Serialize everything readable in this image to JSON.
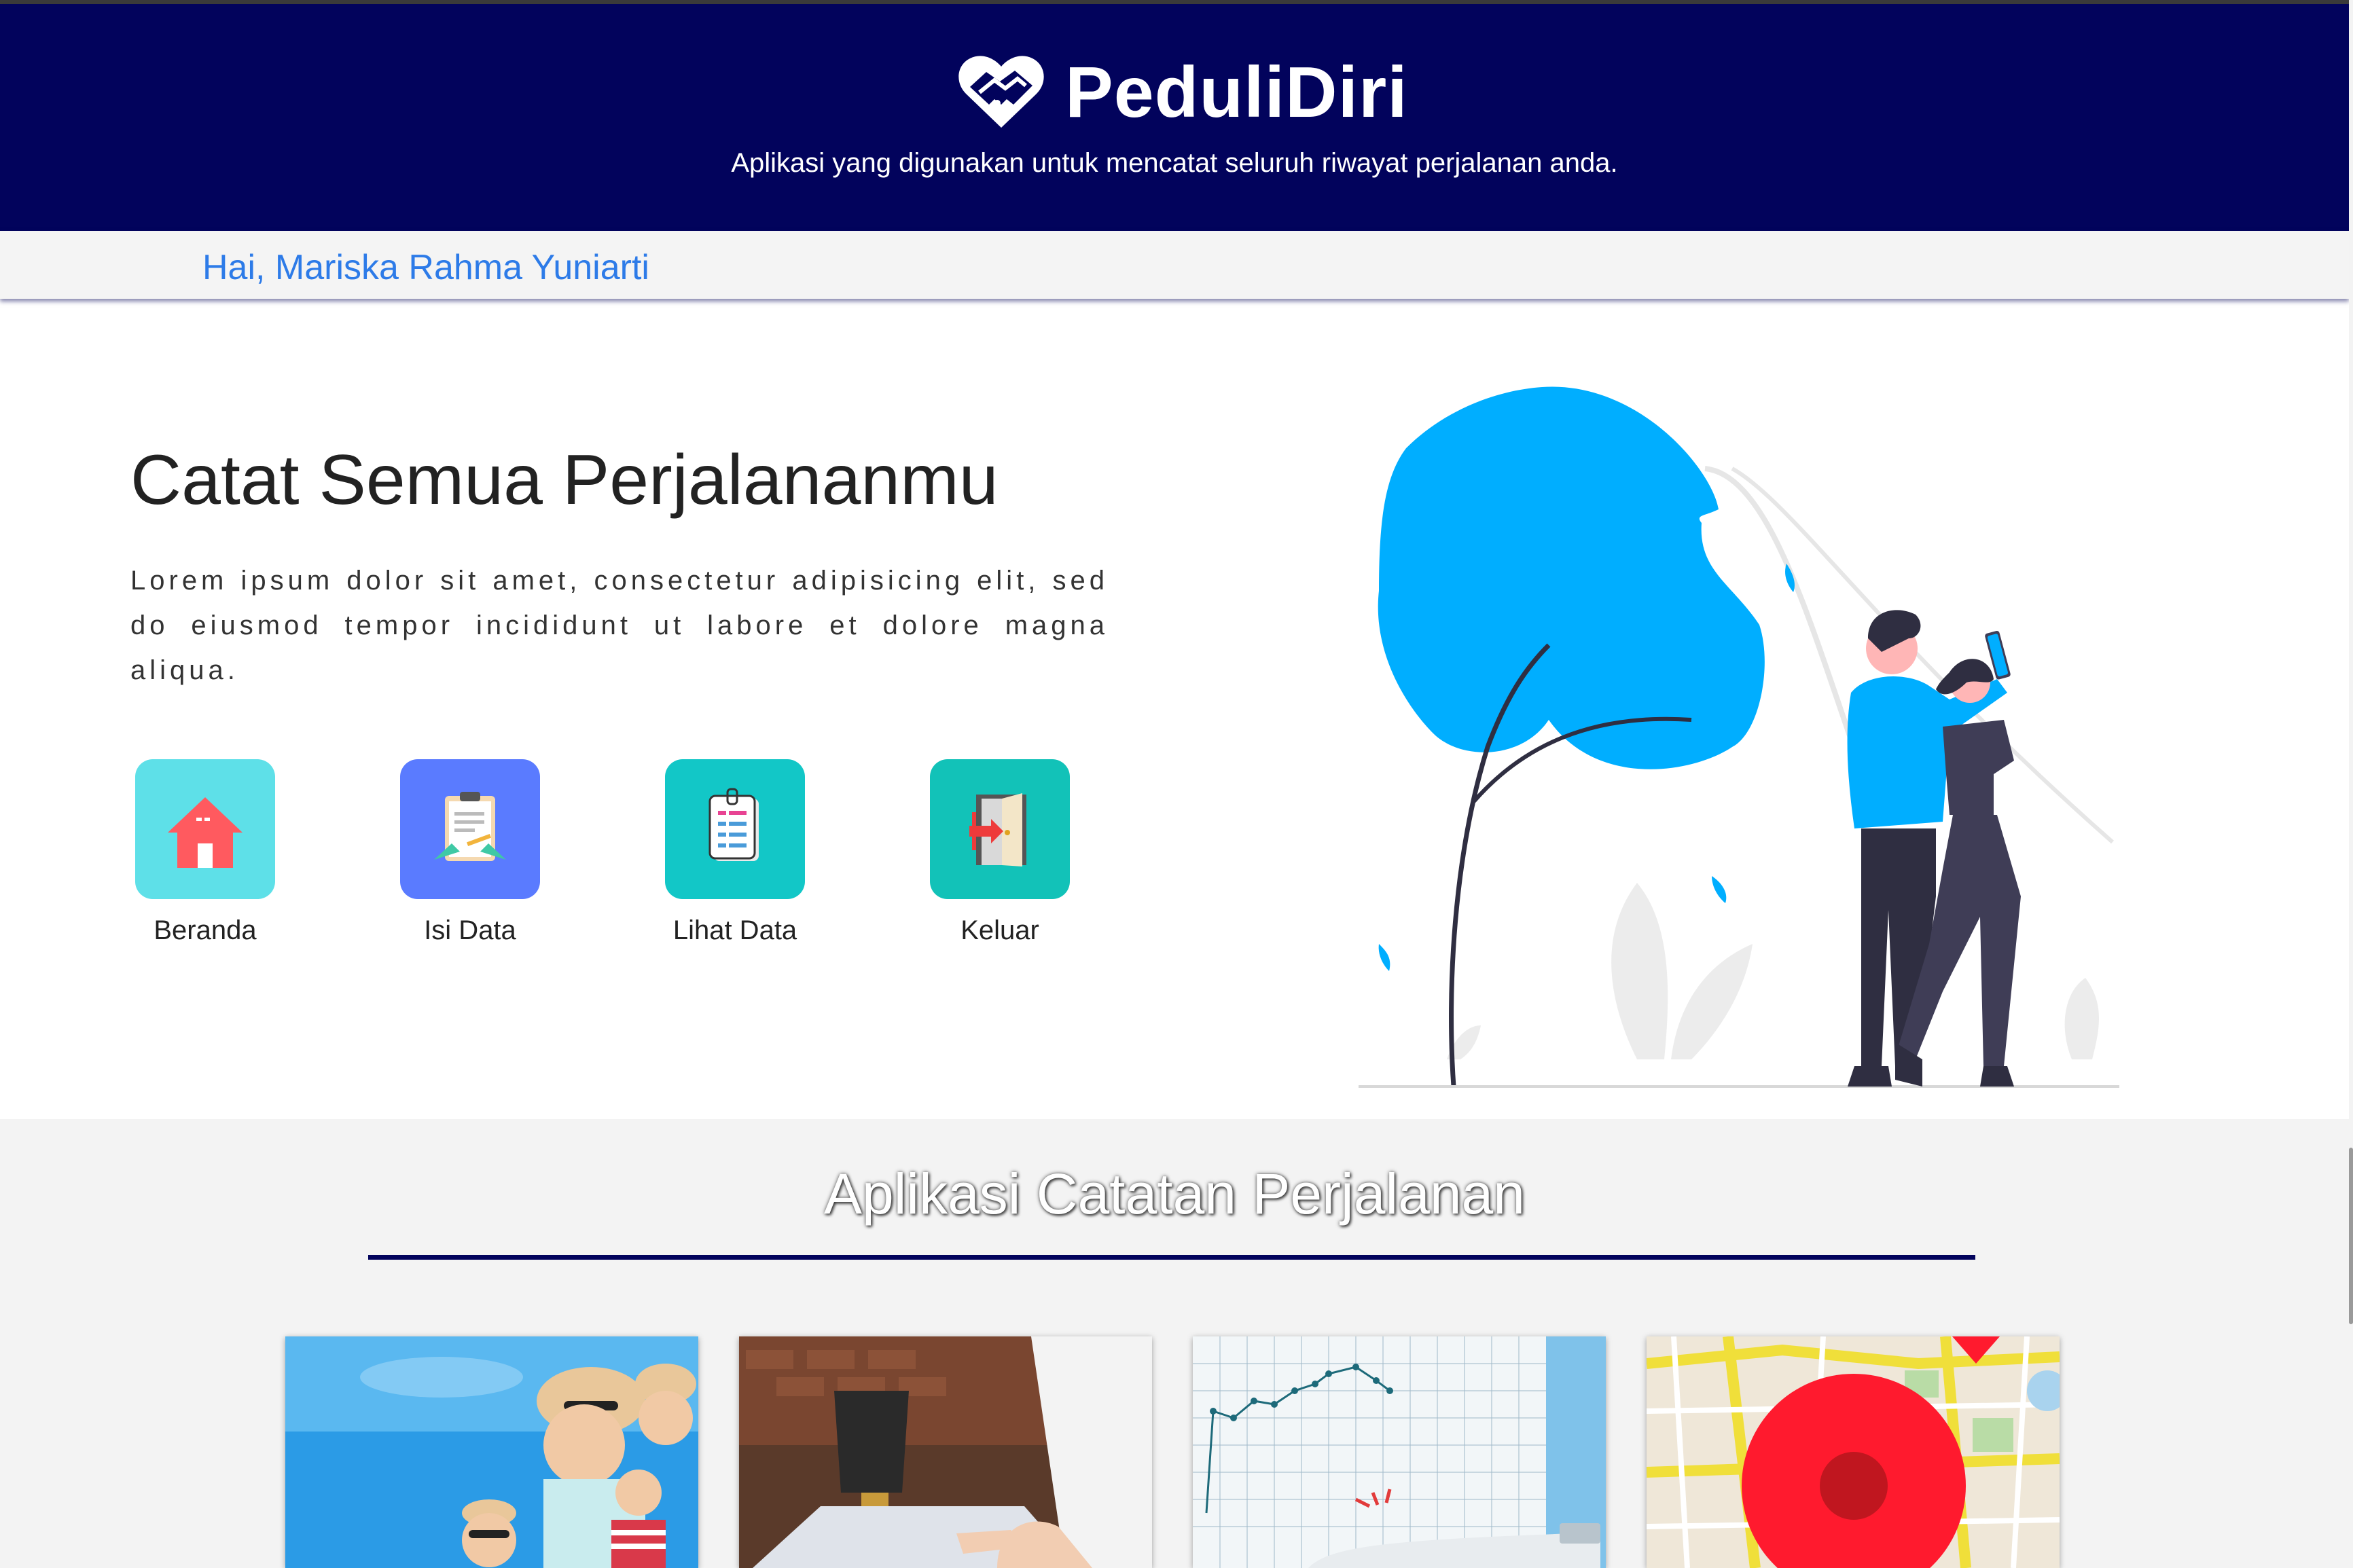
{
  "header": {
    "brand_name": "PeduliDiri",
    "tagline": "Aplikasi yang digunakan untuk mencatat seluruh riwayat perjalanan anda.",
    "logo_icon": "heart-handshake-icon"
  },
  "user": {
    "greeting": "Hai, Mariska Rahma Yuniarti"
  },
  "hero": {
    "title": "Catat Semua Perjalananmu",
    "text": "Lorem ipsum dolor sit amet, consectetur adipisicing elit, sed do eiusmod tempor incididunt ut labore et dolore magna aliqua."
  },
  "menu": [
    {
      "label": "Beranda",
      "icon": "home-icon",
      "color": "#5ee0e8"
    },
    {
      "label": "Isi Data",
      "icon": "clipboard-icon",
      "color": "#5a7bff"
    },
    {
      "label": "Lihat Data",
      "icon": "document-icon",
      "color": "#12c7c7"
    },
    {
      "label": "Keluar",
      "icon": "exit-door-icon",
      "color": "#12c2b8"
    }
  ],
  "section": {
    "title": "Aplikasi Catatan Perjalanan",
    "cards": [
      {
        "name": "family-travel-photo"
      },
      {
        "name": "laptop-tea-photo"
      },
      {
        "name": "chart-thermometer-photo"
      },
      {
        "name": "map-pin-photo"
      }
    ]
  },
  "colors": {
    "header": "#02035c",
    "accent": "#2d7be8",
    "illustration_blue": "#00aeff"
  }
}
